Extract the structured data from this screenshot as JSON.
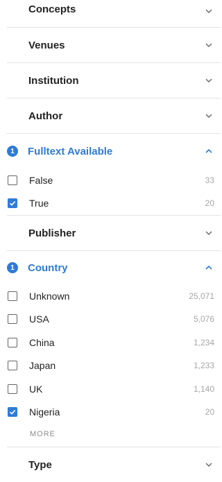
{
  "sections_top": [
    {
      "key": "concepts",
      "title": "Concepts"
    },
    {
      "key": "venues",
      "title": "Venues"
    },
    {
      "key": "institution",
      "title": "Institution"
    },
    {
      "key": "author",
      "title": "Author"
    }
  ],
  "fulltext": {
    "title": "Fulltext Available",
    "badge": "1",
    "options": [
      {
        "label": "False",
        "count": "33",
        "checked": false
      },
      {
        "label": "True",
        "count": "20",
        "checked": true
      }
    ]
  },
  "publisher": {
    "title": "Publisher"
  },
  "country": {
    "title": "Country",
    "badge": "1",
    "options": [
      {
        "label": "Unknown",
        "count": "25,071",
        "checked": false
      },
      {
        "label": "USA",
        "count": "5,076",
        "checked": false
      },
      {
        "label": "China",
        "count": "1,234",
        "checked": false
      },
      {
        "label": "Japan",
        "count": "1,233",
        "checked": false
      },
      {
        "label": "UK",
        "count": "1,140",
        "checked": false
      },
      {
        "label": "Nigeria",
        "count": "20",
        "checked": true
      }
    ],
    "more_label": "MORE"
  },
  "type": {
    "title": "Type"
  },
  "colors": {
    "accent": "#2f7bd6",
    "muted": "#a6a6a6",
    "divider": "#e3e3e3"
  }
}
